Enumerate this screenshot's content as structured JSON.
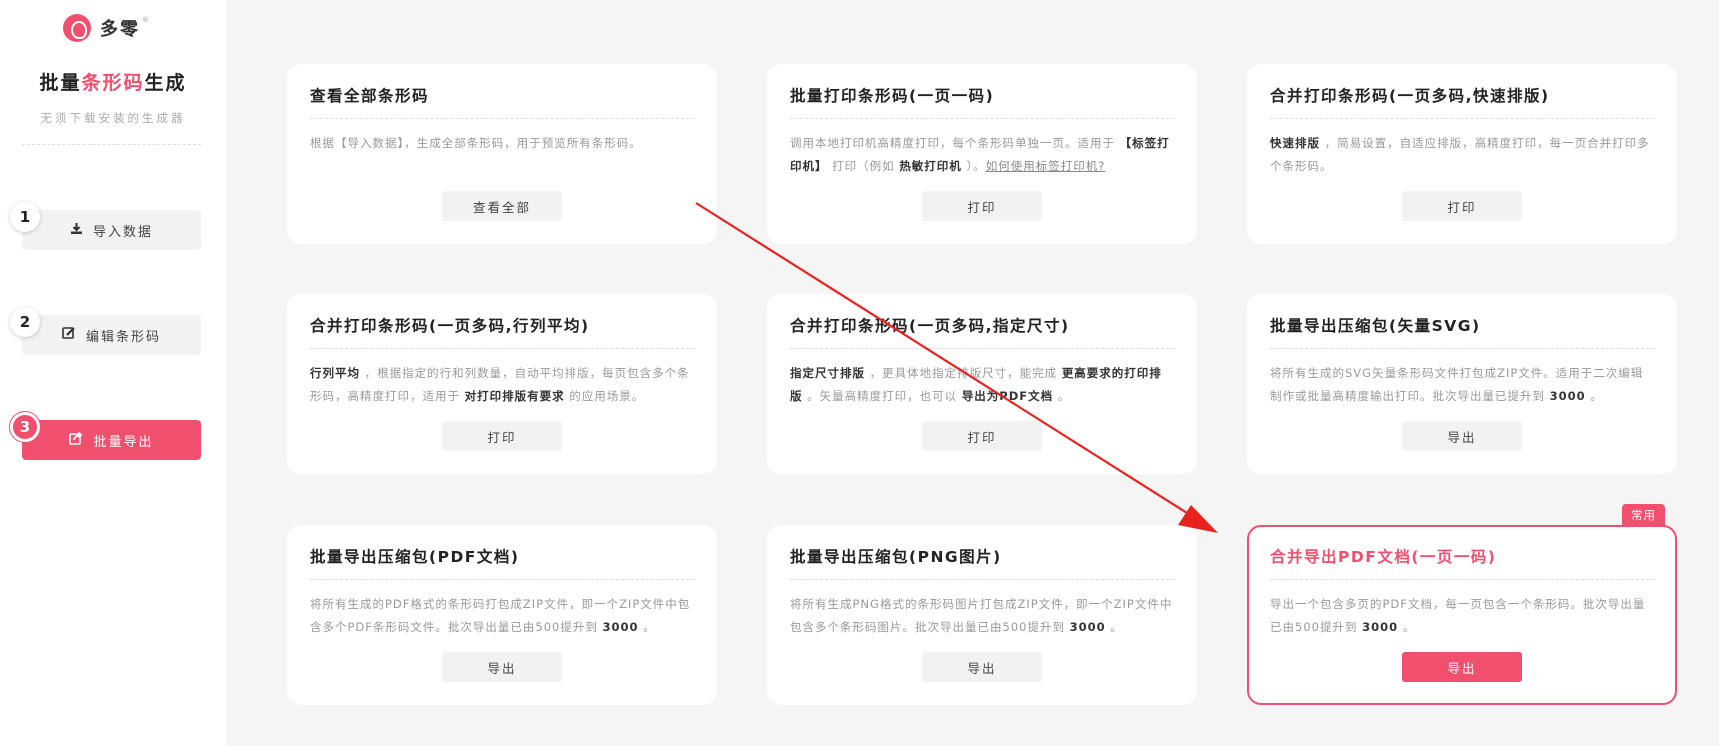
{
  "sidebar": {
    "brand": "多零",
    "brand_reg": "®",
    "title_pre": "批量",
    "title_hl": "条形码",
    "title_post": "生成",
    "subtitle": "无须下载安装的生成器",
    "steps": [
      {
        "num": "1",
        "label": "导入数据",
        "icon": "download-icon"
      },
      {
        "num": "2",
        "label": "编辑条形码",
        "icon": "edit-icon"
      },
      {
        "num": "3",
        "label": "批量导出",
        "icon": "share-icon"
      }
    ]
  },
  "cards": [
    {
      "title": "查看全部条形码",
      "desc": [
        {
          "t": "根据【导入数据】，生成全部条形码，用于预览所有条形码。"
        }
      ],
      "button": "查看全部"
    },
    {
      "title": "批量打印条形码(一页一码)",
      "desc": [
        {
          "t": "调用本地打印机高精度打印，每个条形码单独一页。适用于 "
        },
        {
          "t": "【标签打印机】",
          "b": true
        },
        {
          "t": " 打印（例如 "
        },
        {
          "t": "热敏打印机",
          "b": true
        },
        {
          "t": " ）。"
        },
        {
          "t": "如何使用标签打印机?",
          "u": true
        }
      ],
      "button": "打印"
    },
    {
      "title": "合并打印条形码(一页多码,快速排版)",
      "desc": [
        {
          "t": "快速排版",
          "b": true
        },
        {
          "t": " ，简易设置，自适应排版，高精度打印，每一页合并打印多个条形码。"
        }
      ],
      "button": "打印"
    },
    {
      "title": "合并打印条形码(一页多码,行列平均)",
      "desc": [
        {
          "t": "行列平均",
          "b": true
        },
        {
          "t": " ，根据指定的行和列数量，自动平均排版，每页包含多个条形码，高精度打印，适用于 "
        },
        {
          "t": "对打印排版有要求",
          "b": true
        },
        {
          "t": " 的应用场景。"
        }
      ],
      "button": "打印"
    },
    {
      "title": "合并打印条形码(一页多码,指定尺寸)",
      "desc": [
        {
          "t": "指定尺寸排版",
          "b": true
        },
        {
          "t": " ，更具体地指定排版尺寸，能完成 "
        },
        {
          "t": "更高要求的打印排版",
          "b": true
        },
        {
          "t": " 。矢量高精度打印，也可以 "
        },
        {
          "t": "导出为PDF文档",
          "b": true
        },
        {
          "t": " 。"
        }
      ],
      "button": "打印"
    },
    {
      "title": "批量导出压缩包(矢量SVG)",
      "desc": [
        {
          "t": "将所有生成的SVG矢量条形码文件打包成ZIP文件。适用于二次编辑制作或批量高精度输出打印。批次导出量已提升到 "
        },
        {
          "t": "3000",
          "b": true
        },
        {
          "t": " 。"
        }
      ],
      "button": "导出"
    },
    {
      "title": "批量导出压缩包(PDF文档)",
      "desc": [
        {
          "t": "将所有生成的PDF格式的条形码打包成ZIP文件，即一个ZIP文件中包含多个PDF条形码文件。批次导出量已由500提升到 "
        },
        {
          "t": "3000",
          "b": true
        },
        {
          "t": " 。"
        }
      ],
      "button": "导出"
    },
    {
      "title": "批量导出压缩包(PNG图片)",
      "desc": [
        {
          "t": "将所有生成PNG格式的条形码图片打包成ZIP文件，即一个ZIP文件中包含多个条形码图片。批次导出量已由500提升到 "
        },
        {
          "t": "3000",
          "b": true
        },
        {
          "t": " 。"
        }
      ],
      "button": "导出"
    },
    {
      "title": "合并导出PDF文档(一页一码)",
      "desc": [
        {
          "t": "导出一个包含多页的PDF文档，每一页包含一个条形码。批次导出量已由500提升到 "
        },
        {
          "t": "3000",
          "b": true
        },
        {
          "t": " 。"
        }
      ],
      "button": "导出",
      "badge": "常用",
      "highlight": true
    }
  ],
  "colors": {
    "accent": "#f0506e",
    "annotation_arrow": "#e8231f"
  }
}
